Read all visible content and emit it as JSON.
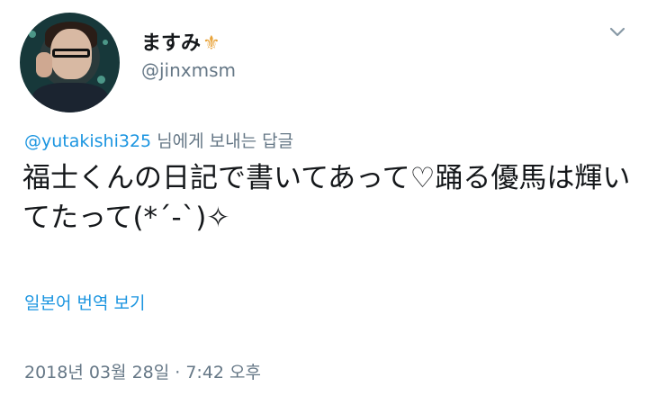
{
  "user": {
    "display_name": "ますみ",
    "name_emoji": "⚜",
    "handle": "@jinxmsm"
  },
  "icons": {
    "more": "chevron-down-icon",
    "name_badge": "fleur-de-lis-icon"
  },
  "reply": {
    "mention": "@yutakishi325",
    "suffix": " 님에게 보내는 답글"
  },
  "tweet": {
    "text": "福士くんの日記で書いてあって♡踊る優馬は輝いてたって(*´-`)✧"
  },
  "actions": {
    "translate_label": "일본어 번역 보기"
  },
  "meta": {
    "timestamp": "2018년 03월 28일 · 7:42 오후"
  },
  "colors": {
    "link": "#1b95e0",
    "secondary": "#657786",
    "text": "#14171a"
  }
}
